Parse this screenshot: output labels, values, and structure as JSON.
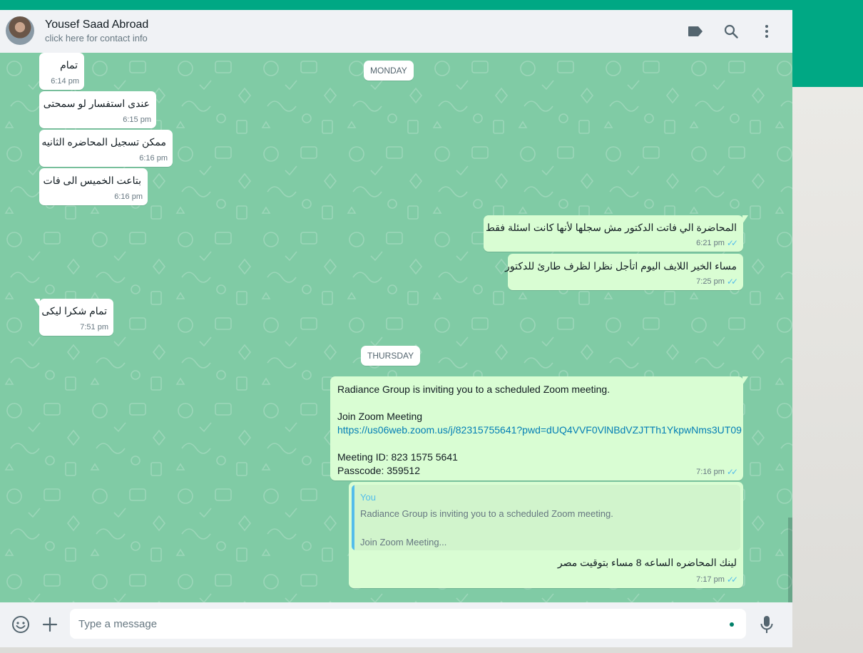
{
  "contact": {
    "name": "Yousef Saad Abroad",
    "subtitle": "click here for contact info"
  },
  "header_icons": [
    "label-icon",
    "search-icon",
    "menu-icon"
  ],
  "day_separators": {
    "monday": "MONDAY",
    "thursday": "THURSDAY"
  },
  "messages": [
    {
      "text": "تمام",
      "time": "6:14 pm"
    },
    {
      "text": "عندى استفسار لو سمحتى",
      "time": "6:15 pm"
    },
    {
      "text": "ممكن تسجيل المحاضره الثانيه",
      "time": "6:16 pm"
    },
    {
      "text": "بتاعت الخميس الى فات",
      "time": "6:16 pm"
    },
    {
      "text": "المحاضرة الي فاتت الدكتور مش سجلها لأنها كانت اسئلة فقط",
      "time": "6:21 pm"
    },
    {
      "text": "مساء الخير اللايف اليوم اتأجل نظرا لظرف طارئ للدكتور",
      "time": "7:25 pm"
    },
    {
      "text": "تمام شكرا ليكى",
      "time": "7:51 pm"
    }
  ],
  "zoom_message": {
    "line1": "Radiance Group is inviting you to a scheduled Zoom meeting.",
    "line2": "Join Zoom Meeting",
    "link": "https://us06web.zoom.us/j/82315755641?pwd=dUQ4VVF0VlNBdVZJTTh1YkpwNms3UT09",
    "meeting_id": "Meeting ID: 823 1575 5641",
    "passcode": "Passcode: 359512",
    "time": "7:16 pm"
  },
  "reply_message": {
    "quote_author": "You",
    "quote_line1": "Radiance Group is inviting you to a scheduled Zoom meeting.",
    "quote_line2": "Join Zoom Meeting...",
    "text": "لينك المحاضره الساعه 8 مساء بتوقيت مصر",
    "time": "7:17 pm"
  },
  "composer": {
    "placeholder": "Type a message"
  },
  "colors": {
    "accent": "#00a884",
    "chat_bg": "#80cba5",
    "outgoing": "#d9fdd3",
    "incoming": "#ffffff",
    "read_ticks": "#53bdeb"
  }
}
